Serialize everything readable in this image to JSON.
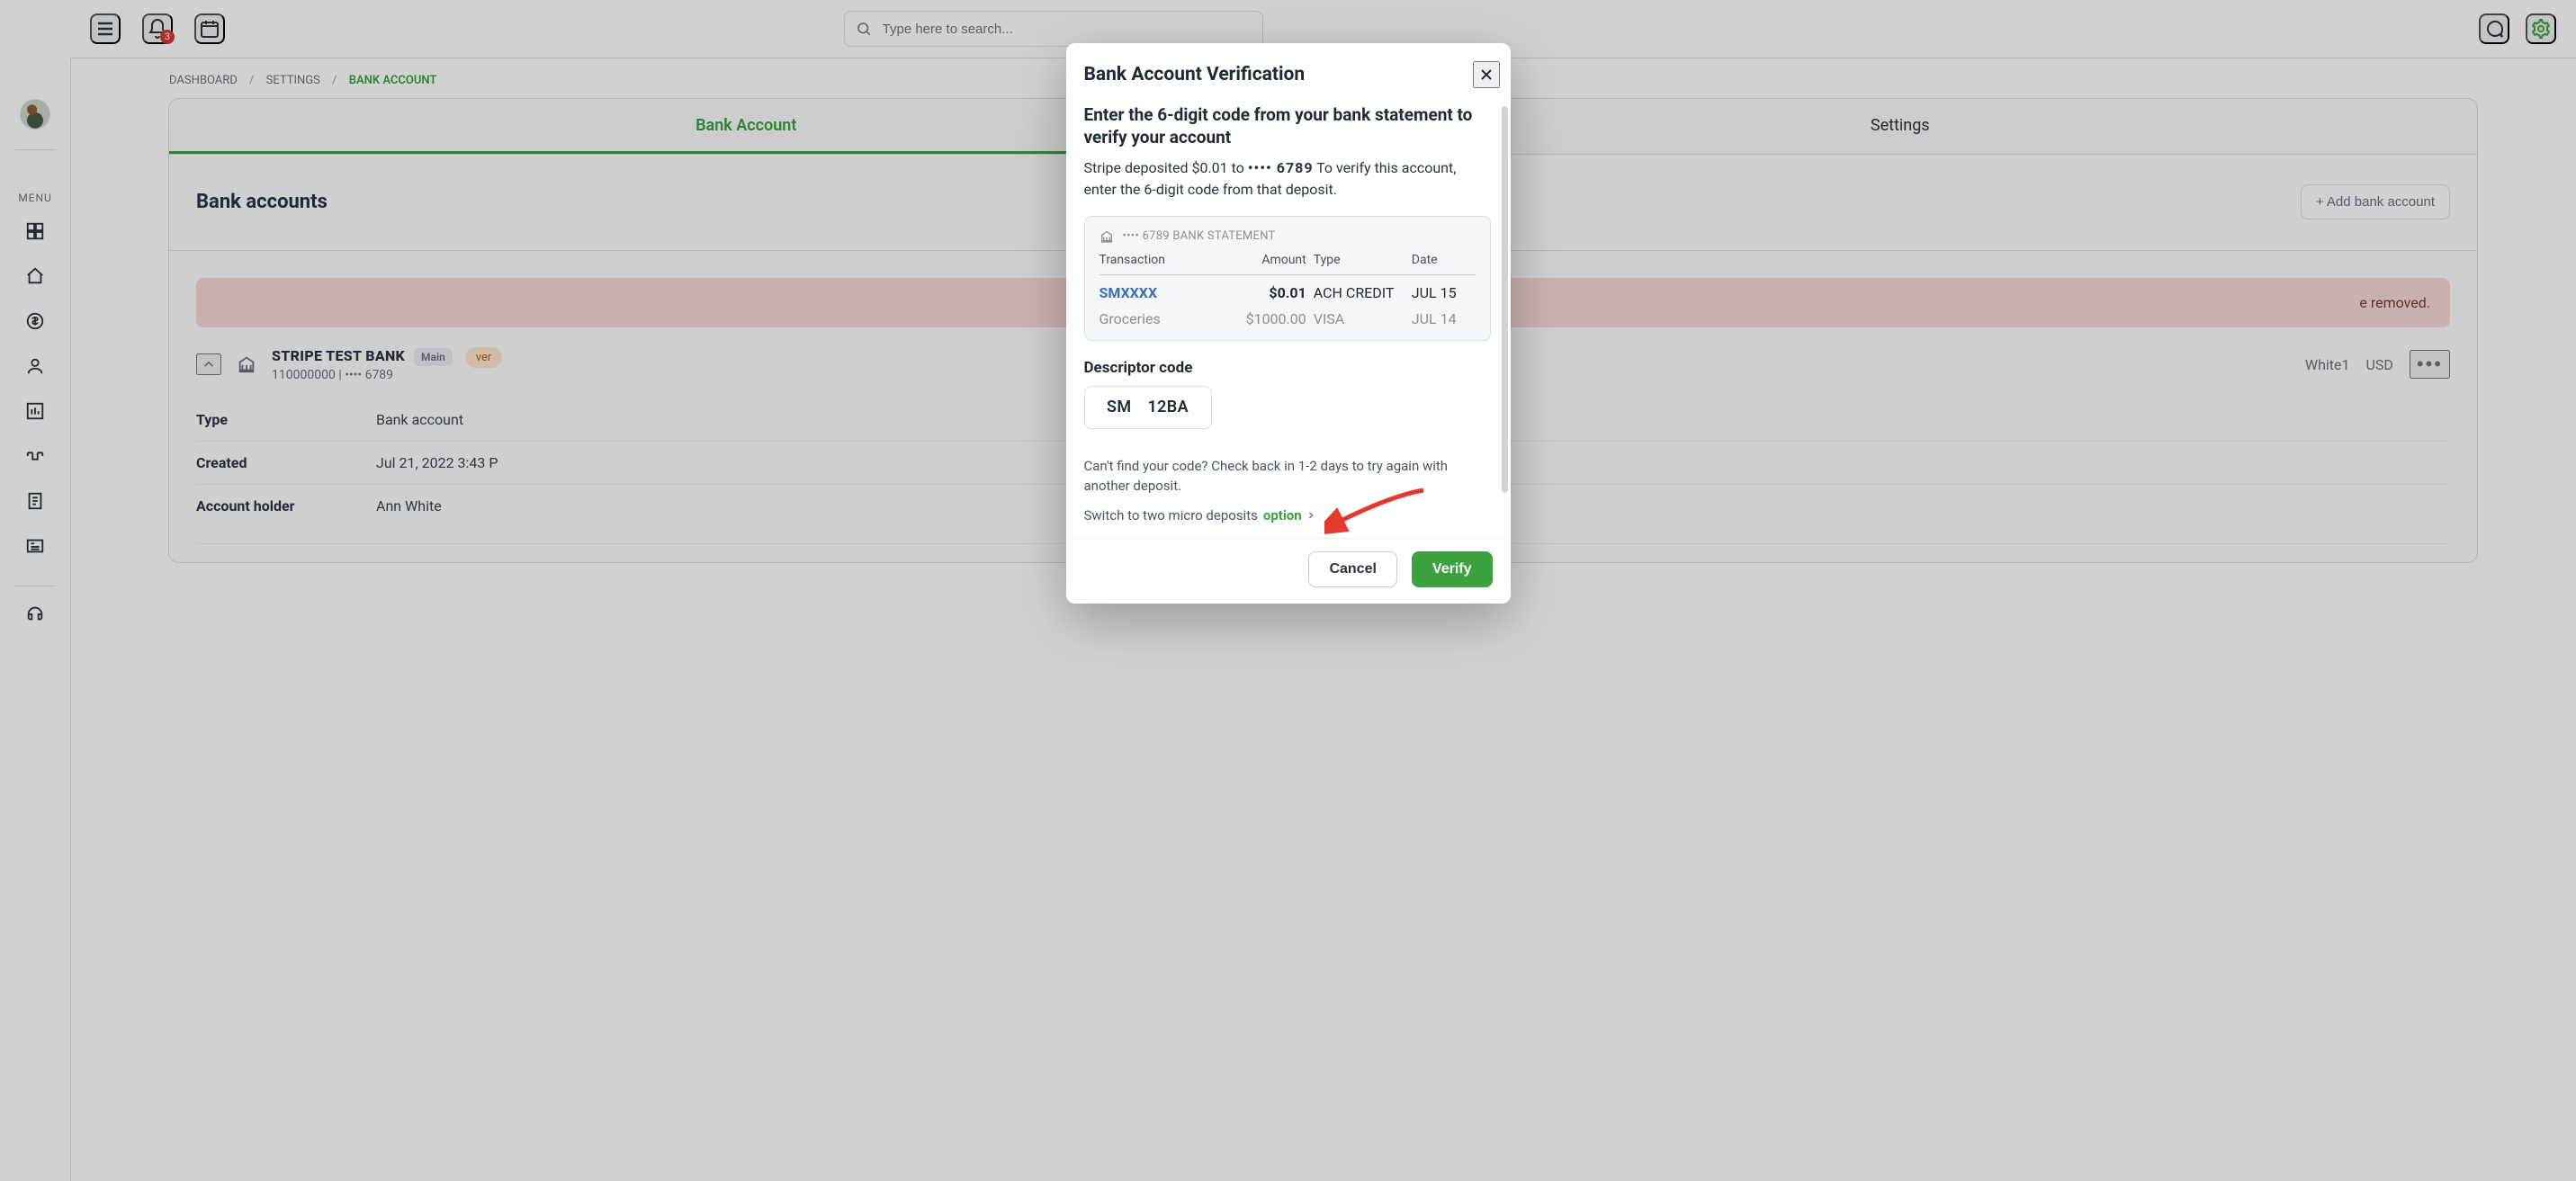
{
  "header": {
    "search_placeholder": "Type here to search...",
    "notification_count": "3"
  },
  "sidebar": {
    "menu_label": "MENU"
  },
  "breadcrumbs": {
    "items": [
      "DASHBOARD",
      "SETTINGS",
      "BANK ACCOUNT"
    ]
  },
  "tabs": {
    "items": [
      {
        "label": "Bank Account",
        "active": true
      },
      {
        "label": "Settings",
        "active": false
      }
    ]
  },
  "section": {
    "title": "Bank accounts",
    "add_button": "+ Add bank account"
  },
  "banner": {
    "trailing_text": "e removed."
  },
  "account": {
    "bank": "STRIPE TEST BANK",
    "chip": "Main",
    "pill": "ver",
    "routing": "110000000",
    "last4": "•••• 6789",
    "holder_right": "White1",
    "currency": "USD",
    "kv": [
      {
        "k": "Type",
        "v": "Bank account"
      },
      {
        "k": "Created",
        "v": "Jul 21, 2022 3:43 P"
      },
      {
        "k": "Account holder",
        "v": "Ann White"
      }
    ]
  },
  "modal": {
    "title": "Bank Account Verification",
    "h2": "Enter the 6-digit code from your bank statement to verify your account",
    "p_before": "Stripe deposited $0.01 to ",
    "p_mask": "•••• 6789",
    "p_after": " To verify this account, enter the 6-digit code from that deposit.",
    "statement_label": "•••• 6789 BANK STATEMENT",
    "columns": {
      "tx": "Transaction",
      "amt": "Amount",
      "type": "Type",
      "date": "Date"
    },
    "rows": [
      {
        "tx": "SMXXXX",
        "amt": "$0.01",
        "type": "ACH CREDIT",
        "date": "JUL 15"
      },
      {
        "tx": "Groceries",
        "amt": "$1000.00",
        "type": "VISA",
        "date": "JUL 14"
      }
    ],
    "descriptor_label": "Descriptor code",
    "code_prefix": "SM",
    "code_value": "12BA",
    "hint": "Can't find your code? Check back in 1-2 days to try again with another deposit.",
    "switch_prefix": "Switch to two micro deposits ",
    "switch_link": "option",
    "buttons": {
      "cancel": "Cancel",
      "verify": "Verify"
    }
  },
  "colors": {
    "accent": "#3BA23F",
    "danger": "#D23A2F"
  }
}
